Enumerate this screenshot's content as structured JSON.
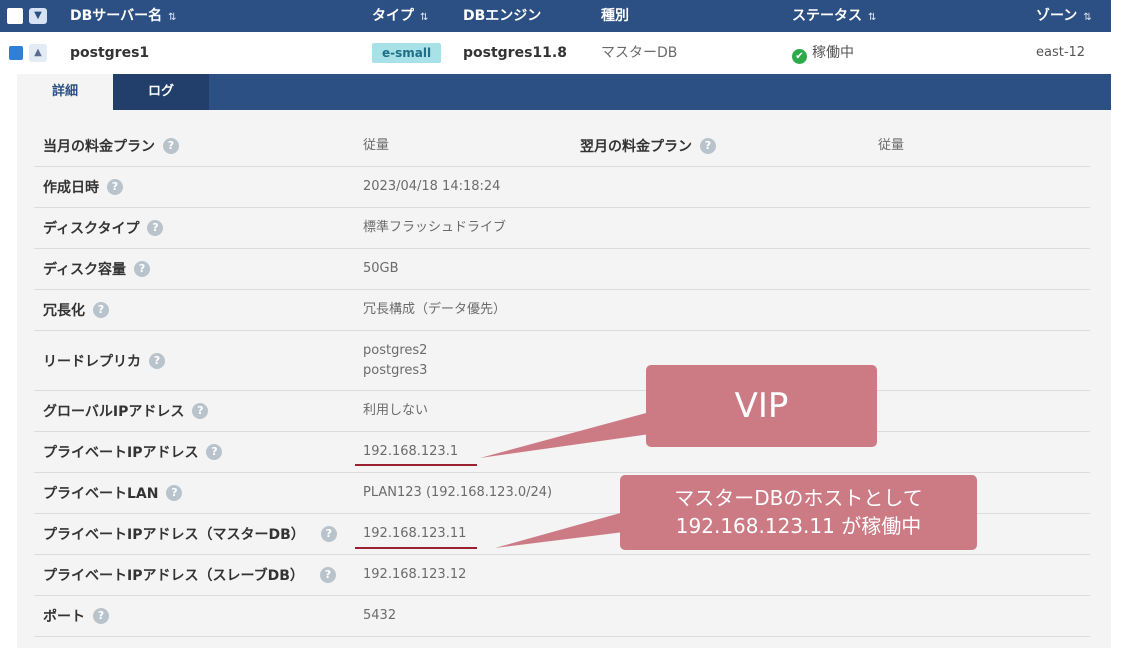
{
  "header": {
    "col_name": "DBサーバー名",
    "col_type": "タイプ",
    "col_engine": "DBエンジン",
    "col_kind": "種別",
    "col_status": "ステータス",
    "col_zone": "ゾーン",
    "sort_icon": "sort-updown-icon"
  },
  "row": {
    "name": "postgres1",
    "type": "e-small",
    "engine": "postgres11.8",
    "kind": "マスターDB",
    "status": "稼働中",
    "zone": "east-12"
  },
  "tabs": {
    "detail": "詳細",
    "log": "ログ"
  },
  "details": {
    "plan_current_label": "当月の料金プラン",
    "plan_current_value": "従量",
    "plan_next_label": "翌月の料金プラン",
    "plan_next_value": "従量",
    "created_label": "作成日時",
    "created_value": "2023/04/18 14:18:24",
    "disk_type_label": "ディスクタイプ",
    "disk_type_value": "標準フラッシュドライブ",
    "disk_size_label": "ディスク容量",
    "disk_size_value": "50GB",
    "redundancy_label": "冗長化",
    "redundancy_value": "冗長構成（データ優先）",
    "replica_label": "リードレプリカ",
    "replica_values": [
      "postgres2",
      "postgres3"
    ],
    "global_ip_label": "グローバルIPアドレス",
    "global_ip_value": "利用しない",
    "private_ip_label": "プライベートIPアドレス",
    "private_ip_value": "192.168.123.1",
    "private_lan_label": "プライベートLAN",
    "private_lan_value": "PLAN123 (192.168.123.0/24)",
    "private_ip_master_label": "プライベートIPアドレス（マスターDB）",
    "private_ip_master_value": "192.168.123.11",
    "private_ip_slave_label": "プライベートIPアドレス（スレーブDB）",
    "private_ip_slave_value": "192.168.123.12",
    "port_label": "ポート",
    "port_value": "5432",
    "help_icon_glyph": "?"
  },
  "callouts": {
    "vip": "VIP",
    "master_line1": "マスターDBのホストとして",
    "master_line2": "192.168.123.11 が稼働中"
  },
  "colors": {
    "header_bg": "#2c5084",
    "callout_bg": "#cc7b85",
    "underline": "#9a2130",
    "status_ok": "#2faa4b"
  }
}
